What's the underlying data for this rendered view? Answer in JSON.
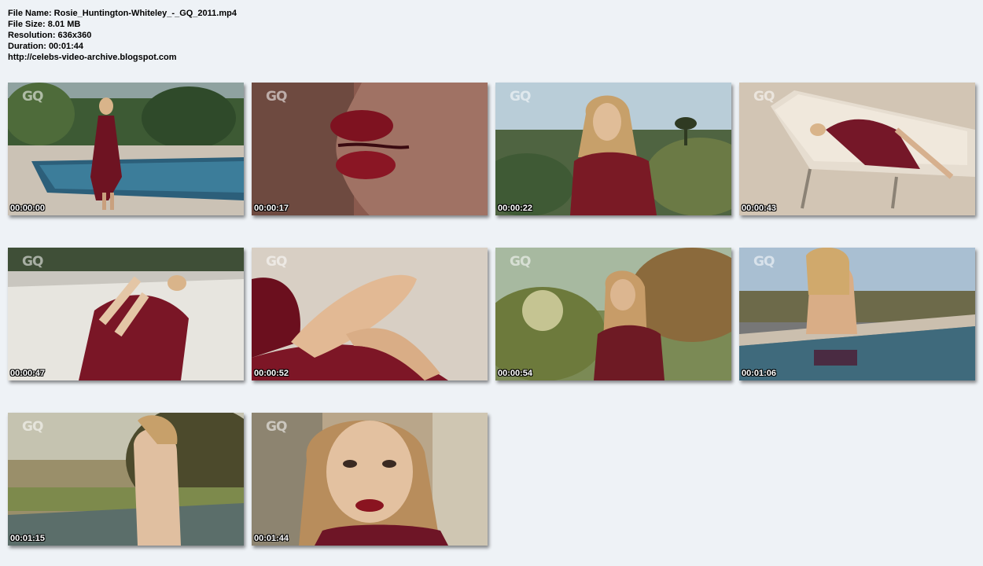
{
  "file_info": {
    "name": "File Name: Rosie_Huntington-Whiteley_-_GQ_2011.mp4",
    "size": "File Size: 8.01 MB",
    "resolution": "Resolution: 636x360",
    "duration": "Duration: 00:01:44",
    "url": "http://celebs-video-archive.blogspot.com"
  },
  "watermark": "GQ",
  "thumbnails": [
    {
      "timestamp": "00:00:00",
      "scene": "poolside-standing"
    },
    {
      "timestamp": "00:00:17",
      "scene": "lips-closeup"
    },
    {
      "timestamp": "00:00:22",
      "scene": "hillside-portrait"
    },
    {
      "timestamp": "00:00:43",
      "scene": "lounger-reclining"
    },
    {
      "timestamp": "00:00:47",
      "scene": "lounger-legs"
    },
    {
      "timestamp": "00:00:52",
      "scene": "legs-closeup"
    },
    {
      "timestamp": "00:00:54",
      "scene": "garden-sunlight"
    },
    {
      "timestamp": "00:01:06",
      "scene": "pool-back-view"
    },
    {
      "timestamp": "00:01:15",
      "scene": "poolside-back"
    },
    {
      "timestamp": "00:01:44",
      "scene": "face-closeup"
    }
  ]
}
